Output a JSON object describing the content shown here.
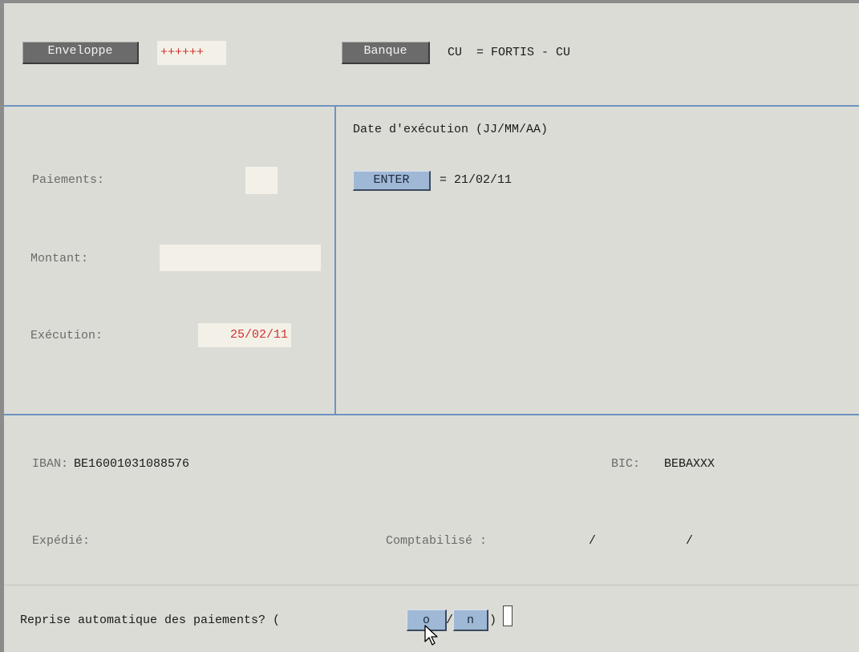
{
  "header": {
    "enveloppe_label": "Enveloppe",
    "enveloppe_value": "++++++",
    "banque_label": "Banque",
    "banque_value": "CU  = FORTIS - CU"
  },
  "left_panel": {
    "paiements_label": "Paiements:",
    "paiements_value": "",
    "montant_label": "Montant:",
    "montant_value": "",
    "execution_label": "Exécution:",
    "execution_value": "25/02/11"
  },
  "right_panel": {
    "date_title": "Date d'exécution (JJ/MM/AA)",
    "enter_label": "ENTER",
    "date_value": "= 21/02/11"
  },
  "bank_info": {
    "iban_label": "IBAN:",
    "iban_value": "BE16001031088576",
    "bic_label": "BIC:",
    "bic_value": "BEBAXXX",
    "expedie_label": "Expédié:",
    "comptabilise_label": "Comptabilisé :",
    "comptabilise_sep1": "/",
    "comptabilise_sep2": "/"
  },
  "prompt": {
    "text": "Reprise automatique des paiements? (",
    "yes_label": "o",
    "separator": "/",
    "no_label": "n",
    "close": ")"
  },
  "colors": {
    "background": "#dcdcd6",
    "divider_blue": "#6f93c0",
    "accent_red": "#d23030",
    "button_blue": "#9fb8d6",
    "button_gray": "#6b6b6b",
    "field_bg": "#f3f1e7"
  }
}
